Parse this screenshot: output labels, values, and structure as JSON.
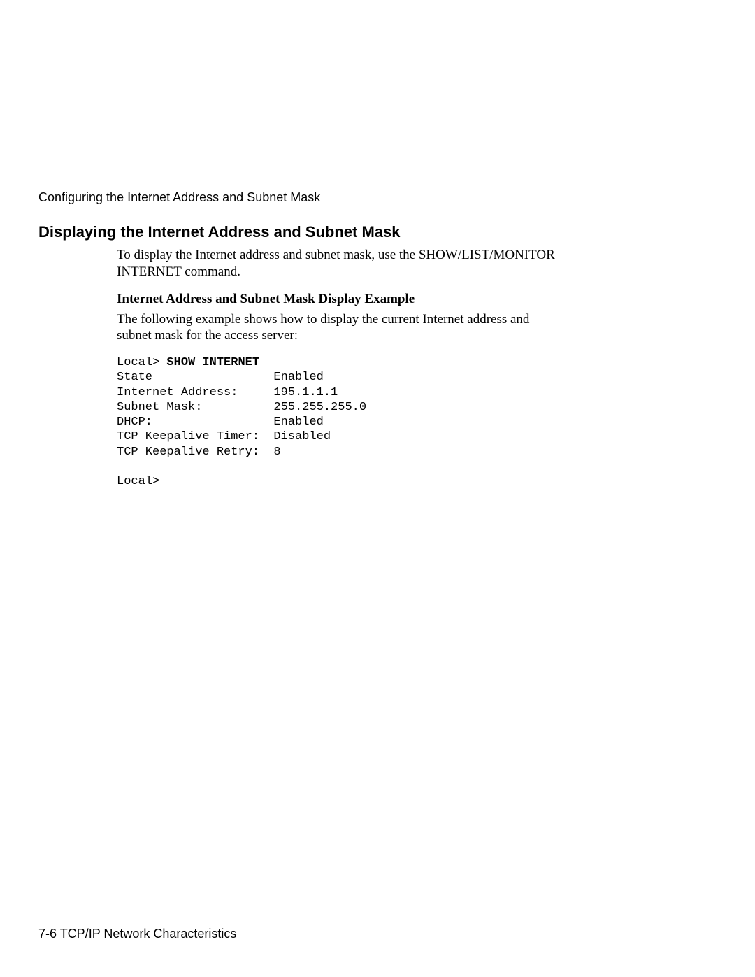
{
  "breadcrumb": "Configuring the Internet Address and Subnet Mask",
  "section_heading": "Displaying the Internet Address and Subnet Mask",
  "intro_paragraph": "To display the Internet address and subnet mask, use the SHOW/LIST/MONITOR INTERNET command.",
  "sub_heading": "Internet Address and Subnet Mask Display Example",
  "example_intro": "The following example shows how to display the current Internet address and subnet mask for the access server:",
  "terminal": {
    "prompt1": "Local> ",
    "command": "SHOW INTERNET",
    "output": "State                 Enabled\nInternet Address:     195.1.1.1\nSubnet Mask:          255.255.255.0\nDHCP:                 Enabled\nTCP Keepalive Timer:  Disabled\nTCP Keepalive Retry:  8\n\nLocal>"
  },
  "footer": "7-6  TCP/IP Network Characteristics"
}
